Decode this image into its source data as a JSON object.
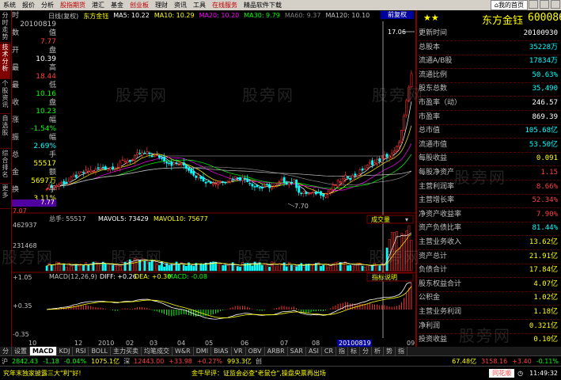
{
  "menu": {
    "items": [
      "系统",
      "报价",
      "分析",
      "股指期货",
      "港汇",
      "基金",
      "创业板",
      "理财",
      "资讯",
      "工具",
      "在线服务",
      "精品软件下载"
    ],
    "red_items": [
      "股指期货",
      "创业板",
      "在线服务"
    ],
    "my_home": "我的首页"
  },
  "left_tabs": [
    "分时走势",
    "技术分析",
    "个股资讯",
    "自选股",
    "综合排名",
    "更多"
  ],
  "title": {
    "period": "日线(复权)",
    "name": "东方金钰",
    "ma5": "MA5: 10.22",
    "ma10": "MA10: 10.29",
    "ma20": "MA20: 10.20",
    "ma30": "MA30: 9.79",
    "ma60": "MA60: 9.37",
    "ma120": "MA120: 10.10"
  },
  "info_box": [
    {
      "l": "时",
      "v": "",
      "c": "#c0c0c0"
    },
    {
      "l": "",
      "v": "20100819",
      "c": "#c0c0c0"
    },
    {
      "l": "数",
      "v": "值",
      "c": "#c0c0c0"
    },
    {
      "l": "",
      "v": "7.77",
      "c": "#ff4040"
    },
    {
      "l": "开",
      "v": "盘",
      "c": "#c0c0c0"
    },
    {
      "l": "",
      "v": "10.39",
      "c": "#ffffff"
    },
    {
      "l": "最",
      "v": "高",
      "c": "#c0c0c0"
    },
    {
      "l": "",
      "v": "18.44",
      "c": "#ff4040"
    },
    {
      "l": "最",
      "v": "低",
      "c": "#c0c0c0"
    },
    {
      "l": "",
      "v": "10.16",
      "c": "#00ff00"
    },
    {
      "l": "收",
      "v": "盘",
      "c": "#c0c0c0"
    },
    {
      "l": "",
      "v": "10.23",
      "c": "#00ff00"
    },
    {
      "l": "涨",
      "v": "幅",
      "c": "#c0c0c0"
    },
    {
      "l": "",
      "v": "-1.54%",
      "c": "#00ff00"
    },
    {
      "l": "振",
      "v": "幅",
      "c": "#c0c0c0"
    },
    {
      "l": "",
      "v": "2.69%",
      "c": "#00ffff"
    },
    {
      "l": "总",
      "v": "手",
      "c": "#c0c0c0"
    },
    {
      "l": "",
      "v": "55517",
      "c": "#ffff00"
    },
    {
      "l": "金",
      "v": "额",
      "c": "#c0c0c0"
    },
    {
      "l": "",
      "v": "5697万",
      "c": "#ffff00"
    },
    {
      "l": "换",
      "v": "手",
      "c": "#c0c0c0"
    },
    {
      "l": "",
      "v": "3.11%",
      "c": "#ffff00"
    }
  ],
  "info_highlight": "7.77",
  "price_axis": {
    "top_label": "17.06",
    "low_label": "7.77",
    "bottom_label": "7.07",
    "low_marker": "7.70"
  },
  "volume": {
    "label": "总手: 55517",
    "mavol5": "MAVOL5: 73429",
    "mavol10": "MAVOL10: 75677",
    "max": "462937",
    "mid": "231468",
    "button": "成交量"
  },
  "macd": {
    "label": "MACD(12,26,9)",
    "diff": "DIFF: +0.26",
    "dea": "DEA: +0.30",
    "macd": "MACD: -0.08",
    "tick_top": "+1.05",
    "tick_mid": "+0.35",
    "tick_bot": "-0.35",
    "button": "指标说明"
  },
  "dates": [
    "10",
    "12",
    "2010",
    "02",
    "03",
    "04",
    "05",
    "06",
    "07",
    "08",
    "09"
  ],
  "date_highlight": "20100819",
  "quote_tag": "前复权",
  "right_panel": {
    "name": "东方金钰",
    "code": "600086",
    "rows": [
      {
        "l": "更新时间",
        "v": "20100930",
        "c": "#ffffff"
      },
      {
        "l": "总股本",
        "v": "35228万",
        "c": "#00ffff"
      },
      {
        "l": "流通A/B股",
        "v": "17834万",
        "c": "#00ffff"
      },
      {
        "l": "流通比例",
        "v": "50.63%",
        "c": "#00ffff"
      },
      {
        "l": "股东总数",
        "v": "35,490",
        "c": "#00ffff"
      },
      {
        "l": "市盈率（动）",
        "v": "246.57",
        "c": "#ffffff"
      },
      {
        "l": "市盈率",
        "v": "869.39",
        "c": "#ffffff"
      },
      {
        "l": "总市值",
        "v": "105.68亿",
        "c": "#00ffff"
      },
      {
        "l": "流通市值",
        "v": "53.50亿",
        "c": "#00ffff"
      },
      {
        "l": "每股收益",
        "v": "0.091",
        "c": "#ffff00"
      },
      {
        "l": "每股净资产",
        "v": "1.15",
        "c": "#ff4040"
      },
      {
        "l": "主营利润率",
        "v": "8.66%",
        "c": "#ff4040"
      },
      {
        "l": "主营增长率",
        "v": "52.34%",
        "c": "#ff4040"
      },
      {
        "l": "净资产收益率",
        "v": "7.90%",
        "c": "#ff4040"
      },
      {
        "l": "资产负债比率",
        "v": "81.44%",
        "c": "#00ffff"
      },
      {
        "l": "主营业务收入",
        "v": "13.62亿",
        "c": "#ffff00"
      },
      {
        "l": "资产总计",
        "v": "21.91亿",
        "c": "#ffff00"
      },
      {
        "l": "负债合计",
        "v": "17.84亿",
        "c": "#ffff00"
      },
      {
        "l": "股东权益合计",
        "v": "4.07亿",
        "c": "#ffff00"
      },
      {
        "l": "公积金",
        "v": "1.02亿",
        "c": "#ffff00"
      },
      {
        "l": "主营业务利润",
        "v": "1.18亿",
        "c": "#ffff00"
      },
      {
        "l": "净利润",
        "v": "0.321亿",
        "c": "#ffff00"
      },
      {
        "l": "投资收益",
        "v": "0.10亿",
        "c": "#ffff00"
      }
    ]
  },
  "bottom_tabs": [
    "分",
    "设置",
    "MACD",
    "KDJ",
    "RSI",
    "BOLL",
    "主力买卖",
    "均笔成交",
    "W&R",
    "DMI",
    "BIAS",
    "VR",
    "OBV",
    "ARBR",
    "SAR",
    "ASI",
    "CR",
    "指",
    "标",
    "分",
    "析",
    "势",
    "指"
  ],
  "status": {
    "sh_label": "沪",
    "sh_index": "2842.43",
    "sh_change": "-1.18",
    "sh_pct": "-0.04%",
    "sh_amount": "1075.1亿",
    "sz_label": "深",
    "sz_index": "12443.00",
    "sz_change": "+33.98",
    "sz_pct": "+0.27%",
    "sz_amount": "993.3亿",
    "cy_label": "创",
    "cy_amount": "67.48亿",
    "cy_index": "3158.16",
    "cy_change": "+3.40",
    "cy_pct": "-0.11%"
  },
  "news": {
    "left": "究年末独家披露三大\"利\"好!",
    "mid": "金牛早评：证监会必查\"老鼠仓\",操盘央票再出场",
    "brand": "同花顺",
    "time": "11:49:32"
  },
  "watermark": "股旁网"
}
